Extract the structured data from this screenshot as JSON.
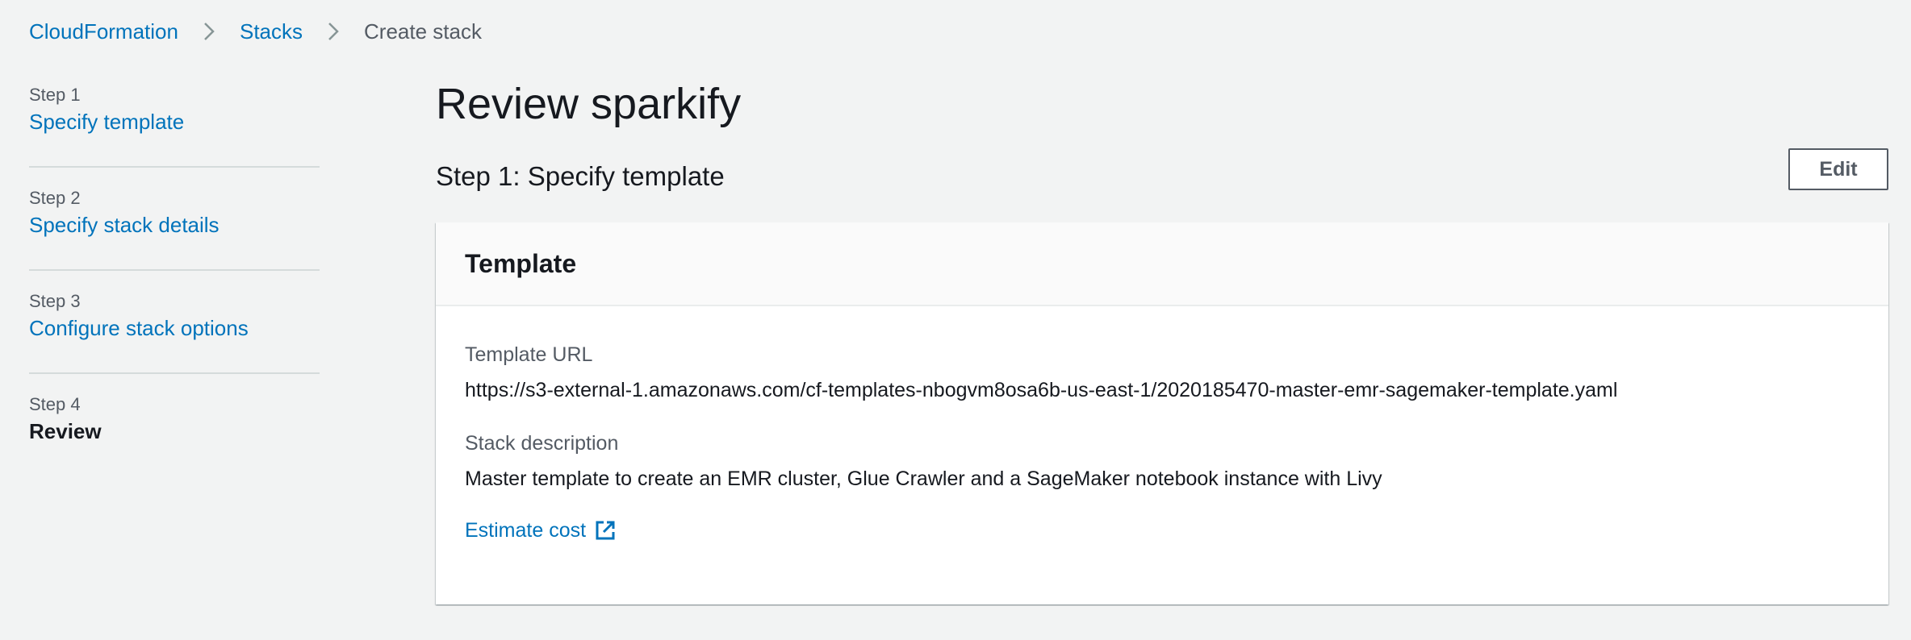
{
  "breadcrumb": {
    "items": [
      "CloudFormation",
      "Stacks"
    ],
    "current": "Create stack"
  },
  "steps": [
    {
      "number": "Step 1",
      "label": "Specify template"
    },
    {
      "number": "Step 2",
      "label": "Specify stack details"
    },
    {
      "number": "Step 3",
      "label": "Configure stack options"
    },
    {
      "number": "Step 4",
      "label": "Review"
    }
  ],
  "main": {
    "title": "Review sparkify",
    "section_title": "Step 1: Specify template",
    "edit_label": "Edit",
    "container": {
      "header": "Template",
      "template_url_label": "Template URL",
      "template_url_value": "https://s3-external-1.amazonaws.com/cf-templates-nbogvm8osa6b-us-east-1/2020185470-master-emr-sagemaker-template.yaml",
      "stack_description_label": "Stack description",
      "stack_description_value": "Master template to create an EMR cluster, Glue Crawler and a SageMaker notebook instance with Livy",
      "estimate_cost_label": "Estimate cost"
    }
  },
  "colors": {
    "link": "#0073bb",
    "background": "#f2f3f3",
    "text": "#16191f",
    "secondary_text": "#545b64"
  },
  "icons": {
    "breadcrumb_separator": "chevron-right-icon",
    "estimate_cost": "external-link-icon"
  }
}
